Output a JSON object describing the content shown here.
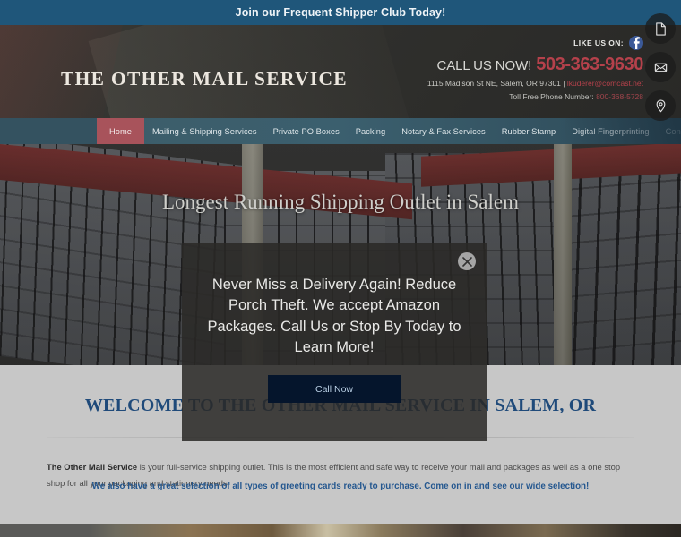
{
  "topbar": {
    "text": "Join our Frequent Shipper Club Today!"
  },
  "header": {
    "logo": "THE OTHER MAIL SERVICE",
    "like_label": "LIKE US ON:",
    "facebook_icon": "facebook-icon",
    "call_label": "CALL US NOW!",
    "call_number": "503-363-9630",
    "address": "1115 Madison St NE, Salem, OR 97301 | ",
    "email": "lkuderer@comcast.net",
    "tollfree_label": "Toll Free Phone Number: ",
    "tollfree_number": "800-368-5728"
  },
  "nav": {
    "items": [
      {
        "label": "Home",
        "active": true
      },
      {
        "label": "Mailing & Shipping Services",
        "active": false
      },
      {
        "label": "Private PO Boxes",
        "active": false
      },
      {
        "label": "Packing",
        "active": false
      },
      {
        "label": "Notary & Fax Services",
        "active": false
      },
      {
        "label": "Rubber Stamp",
        "active": false
      },
      {
        "label": "Digital Fingerprinting",
        "active": false
      },
      {
        "label": "Contact Us",
        "active": false
      }
    ]
  },
  "hero": {
    "caption": "Longest Running Shipping Outlet in Salem"
  },
  "content": {
    "welcome_title": "WELCOME TO THE OTHER MAIL SERVICE IN SALEM, OR",
    "body_bold": "The Other Mail Service",
    "body_rest": " is your full-service shipping outlet. This is the most efficient and safe way to receive your mail and packages as well as a one stop shop for all your packaging and stationery needs.",
    "promo_line": "We also have a great selection of all types of greeting cards ready to purchase. Come on in and see our wide selection!"
  },
  "modal": {
    "message": "Never Miss a Delivery Again! Reduce Porch Theft. We accept Amazon Packages. Call Us or Stop By Today to Learn More!",
    "button_label": "Call Now",
    "close_icon": "close-icon"
  },
  "side_rail": {
    "buttons": [
      {
        "icon": "document-icon"
      },
      {
        "icon": "envelope-icon"
      },
      {
        "icon": "location-pin-icon"
      }
    ]
  },
  "colors": {
    "topbar_blue": "#1f567a",
    "nav_teal": "#3b5f6e",
    "nav_active_red": "#a8535b",
    "accent_red": "#b5414b",
    "heading_navy": "#1f4a7a",
    "promo_blue": "#24578f",
    "modal_button_navy": "#05152c"
  }
}
